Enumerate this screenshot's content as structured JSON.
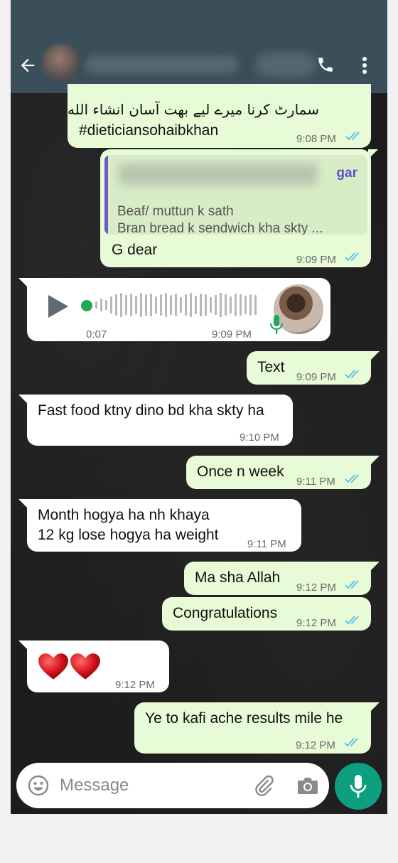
{
  "input": {
    "placeholder": "Message"
  },
  "messages": [
    {
      "dir": "out",
      "lines": [
        "سمارٹ کرنا میرے لیے بهت آسان انشاء الله",
        "#dieticiansohaibkhan"
      ],
      "time": "9:08 PM",
      "ticks": "read"
    },
    {
      "dir": "out",
      "quote": {
        "name": "gar",
        "lines": [
          "Beaf/ muttun k sath",
          "Bran bread k sendwich kha skty ..."
        ]
      },
      "text": "G dear",
      "time": "9:09 PM",
      "ticks": "read"
    },
    {
      "dir": "in",
      "type": "voice",
      "duration": "0:07",
      "time": "9:09 PM"
    },
    {
      "dir": "out",
      "text": "Text",
      "time": "9:09 PM",
      "ticks": "read"
    },
    {
      "dir": "in",
      "text": "Fast food ktny dino bd kha skty ha",
      "time": "9:10 PM"
    },
    {
      "dir": "out",
      "text": "Once n week",
      "time": "9:11 PM",
      "ticks": "read"
    },
    {
      "dir": "in",
      "lines": [
        "Month hogya ha nh khaya",
        "12 kg lose hogya ha weight"
      ],
      "time": "9:11 PM"
    },
    {
      "dir": "out",
      "text": "Ma sha Allah",
      "time": "9:12 PM",
      "ticks": "read"
    },
    {
      "dir": "out",
      "text": "Congratulations",
      "time": "9:12 PM",
      "ticks": "read"
    },
    {
      "dir": "in",
      "text": "❤️❤️",
      "emoji_names": [
        "red-heart",
        "red-heart"
      ],
      "time": "9:12 PM"
    },
    {
      "dir": "out",
      "text": "Ye to kafi ache results mile he",
      "time": "9:12 PM",
      "ticks": "read"
    }
  ],
  "colors": {
    "header": "#3b4f5a",
    "outgoing_bubble": "#e7fcd6",
    "incoming_bubble": "#ffffff",
    "read_ticks": "#53bdeb",
    "accent": "#0e9e80",
    "voice_dot": "#1fa855",
    "quote_name": "#5a4fcf"
  },
  "icons": [
    "back-arrow-icon",
    "call-icon",
    "more-vert-icon",
    "play-icon",
    "mic-icon",
    "emoji-icon",
    "attach-icon",
    "camera-icon",
    "mic-send-icon",
    "double-check-icon"
  ]
}
